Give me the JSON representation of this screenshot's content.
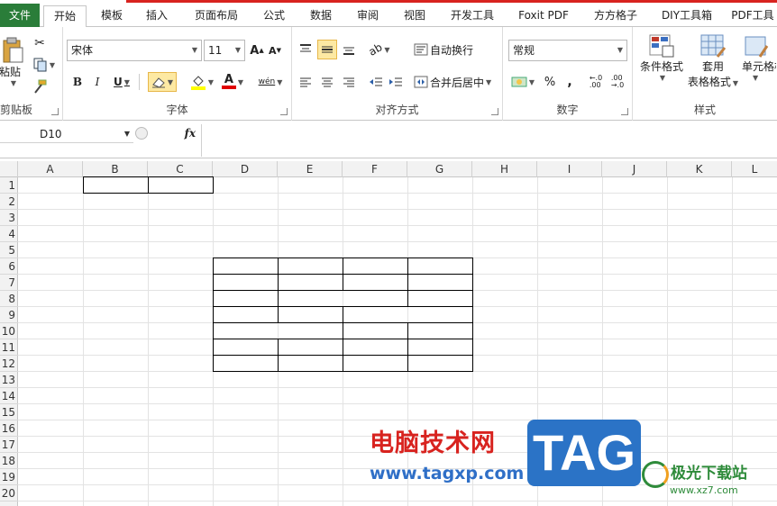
{
  "tabs": {
    "file": "文件",
    "items": [
      "开始",
      "模板",
      "插入",
      "页面布局",
      "公式",
      "数据",
      "审阅",
      "视图",
      "开发工具",
      "Foxit PDF",
      "方方格子",
      "DIY工具箱",
      "PDF工具"
    ],
    "active_index": 0
  },
  "ribbon": {
    "clipboard": {
      "label": "剪贴板",
      "paste": "粘贴"
    },
    "font": {
      "label": "字体",
      "font_name": "宋体",
      "font_size": "11",
      "bold": "B",
      "italic": "I",
      "underline": "U",
      "font_color_glyph": "A",
      "grow": "A",
      "shrink": "A",
      "phonetic": "wén"
    },
    "alignment": {
      "label": "对齐方式",
      "wrap_text": "自动换行",
      "merge_center": "合并后居中"
    },
    "number": {
      "label": "数字",
      "format": "常规",
      "percent": "%",
      "comma": ","
    },
    "styles": {
      "label": "样式",
      "conditional": "条件格式",
      "table_format_1": "套用",
      "table_format_2": "表格格式",
      "cell_styles": "单元格样式"
    }
  },
  "formula_bar": {
    "name_box": "D10",
    "fx": "fx",
    "value": ""
  },
  "columns": [
    "A",
    "B",
    "C",
    "D",
    "E",
    "F",
    "G",
    "H",
    "I",
    "J",
    "K",
    "L"
  ],
  "rows": [
    "1",
    "2",
    "3",
    "4",
    "5",
    "6",
    "7",
    "8",
    "9",
    "10",
    "11",
    "12",
    "13",
    "14",
    "15",
    "16",
    "17",
    "18",
    "19",
    "20"
  ],
  "watermark": {
    "cn": "电脑技术网",
    "url": "www.tagxp.com",
    "tag": "TAG",
    "site": "极光下载站",
    "site_url": "www.xz7.com"
  },
  "colors": {
    "file_tab": "#2a7d39",
    "accent_red": "#d8231f",
    "tag_blue": "#2b73c6",
    "site_green": "#2e8b3a"
  }
}
